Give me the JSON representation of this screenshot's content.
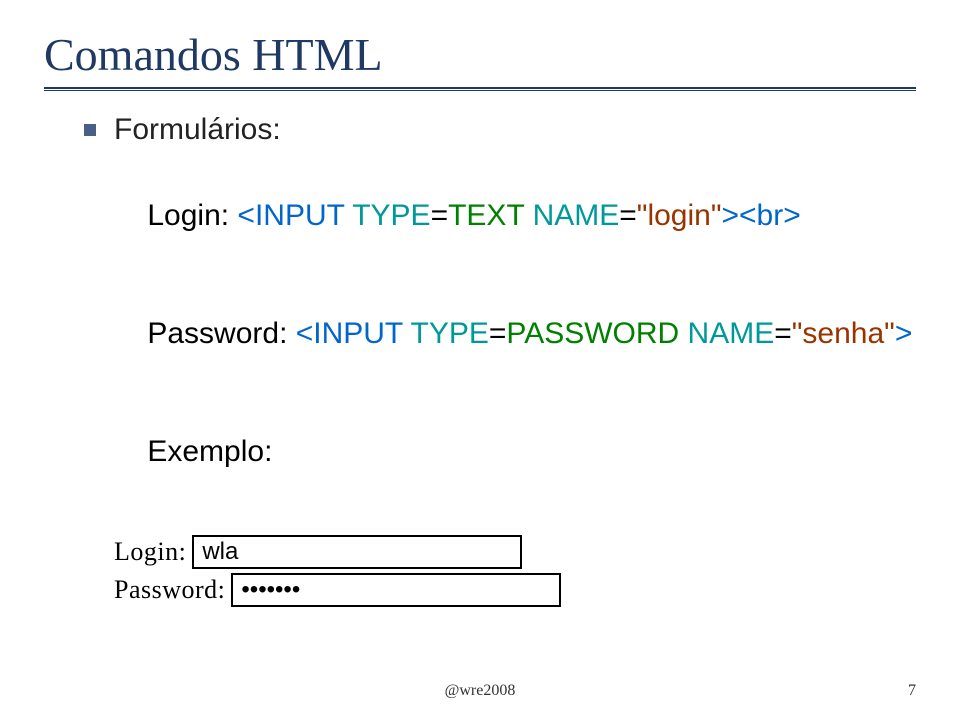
{
  "title": "Comandos HTML",
  "bullet": "Formulários:",
  "code1": {
    "prefix": "Login: ",
    "tag_open": "<INPUT ",
    "type_attr": "TYPE",
    "eq1": "=",
    "type_val": "TEXT",
    "sp": " ",
    "name_attr": "NAME",
    "eq2": "=",
    "name_val": "\"login\"",
    "tag_close": "><br>"
  },
  "code2": {
    "prefix": "Password: ",
    "tag_open": "<INPUT ",
    "type_attr": "TYPE",
    "eq1": "=",
    "type_val": "PASSWORD",
    "sp": " ",
    "name_attr": "NAME",
    "eq2": "=",
    "name_val": "\"senha\"",
    "tag_close": ">"
  },
  "example_label": "Exemplo:",
  "example": {
    "login_label": "Login:",
    "login_value": "wla",
    "password_label": "Password:",
    "password_value": "•••••••"
  },
  "footer": "@wre2008",
  "page": "7"
}
